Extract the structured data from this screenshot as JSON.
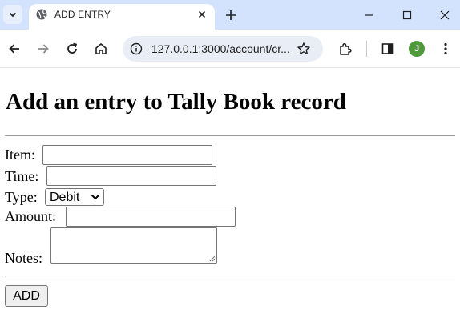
{
  "browser": {
    "tab": {
      "title": "ADD ENTRY"
    },
    "address_bar": {
      "url": "127.0.0.1:3000/account/cr..."
    },
    "profile": {
      "initial": "J",
      "color": "#4f9a3a"
    }
  },
  "page": {
    "heading": "Add an entry to Tally Book record",
    "form": {
      "item": {
        "label": "Item:",
        "value": ""
      },
      "time": {
        "label": "Time:",
        "value": ""
      },
      "type": {
        "label": "Type:",
        "selected": "Debit"
      },
      "amount": {
        "label": "Amount:",
        "value": ""
      },
      "notes": {
        "label": "Notes:",
        "value": ""
      },
      "submit_label": "ADD"
    }
  },
  "colors": {
    "tabbar_bg": "#d3e3fd",
    "omnibox_bg": "#e9eef6",
    "rule": "#9a9a9a"
  }
}
